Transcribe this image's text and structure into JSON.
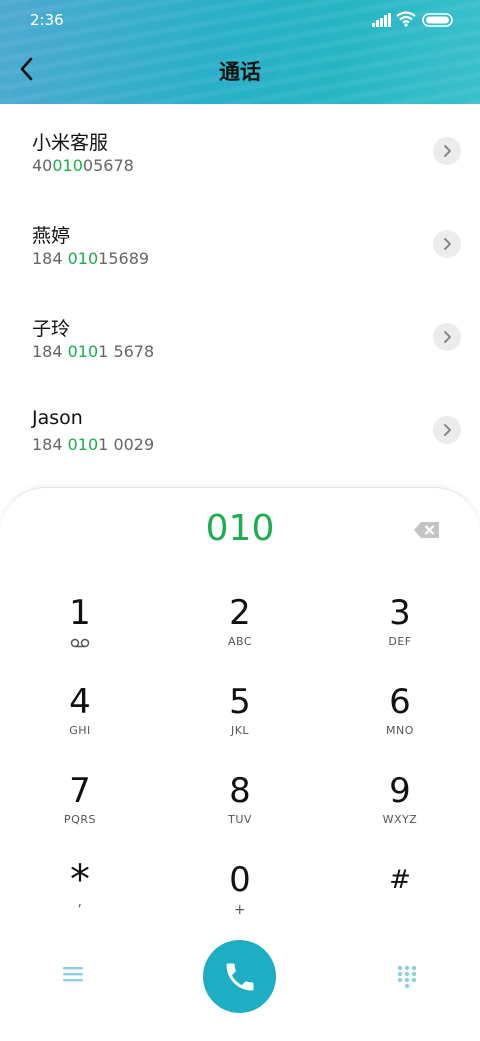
{
  "status_bar": {
    "time": "2:36"
  },
  "header": {
    "title": "通话"
  },
  "contacts": [
    {
      "name": "小米客服",
      "num_pre": "40",
      "num_hl": "010",
      "num_post": "05678"
    },
    {
      "name": "燕婷",
      "num_pre": "184 ",
      "num_hl": "010",
      "num_post": "15689"
    },
    {
      "name": "子玲",
      "num_pre": "184 ",
      "num_hl": "010",
      "num_post": "1 5678"
    },
    {
      "name": "Jason",
      "num_pre": "184 ",
      "num_hl": "010",
      "num_post": "1 0029"
    }
  ],
  "dialer": {
    "typed": "010",
    "keys": [
      {
        "digit": "1",
        "letters": ""
      },
      {
        "digit": "2",
        "letters": "ABC"
      },
      {
        "digit": "3",
        "letters": "DEF"
      },
      {
        "digit": "4",
        "letters": "GHI"
      },
      {
        "digit": "5",
        "letters": "JKL"
      },
      {
        "digit": "6",
        "letters": "MNO"
      },
      {
        "digit": "7",
        "letters": "PQRS"
      },
      {
        "digit": "8",
        "letters": "TUV"
      },
      {
        "digit": "9",
        "letters": "WXYZ"
      },
      {
        "digit": "*",
        "letters": ","
      },
      {
        "digit": "0",
        "letters": "+"
      },
      {
        "digit": "#",
        "letters": ""
      }
    ]
  },
  "colors": {
    "accent": "#1cae4f",
    "call": "#1daec4"
  },
  "icons": [
    "back-arrow-icon",
    "signal-icon",
    "wifi-icon",
    "battery-icon",
    "chevron-right-icon",
    "backspace-icon",
    "voicemail-icon",
    "menu-icon",
    "call-icon",
    "dialpad-icon"
  ]
}
